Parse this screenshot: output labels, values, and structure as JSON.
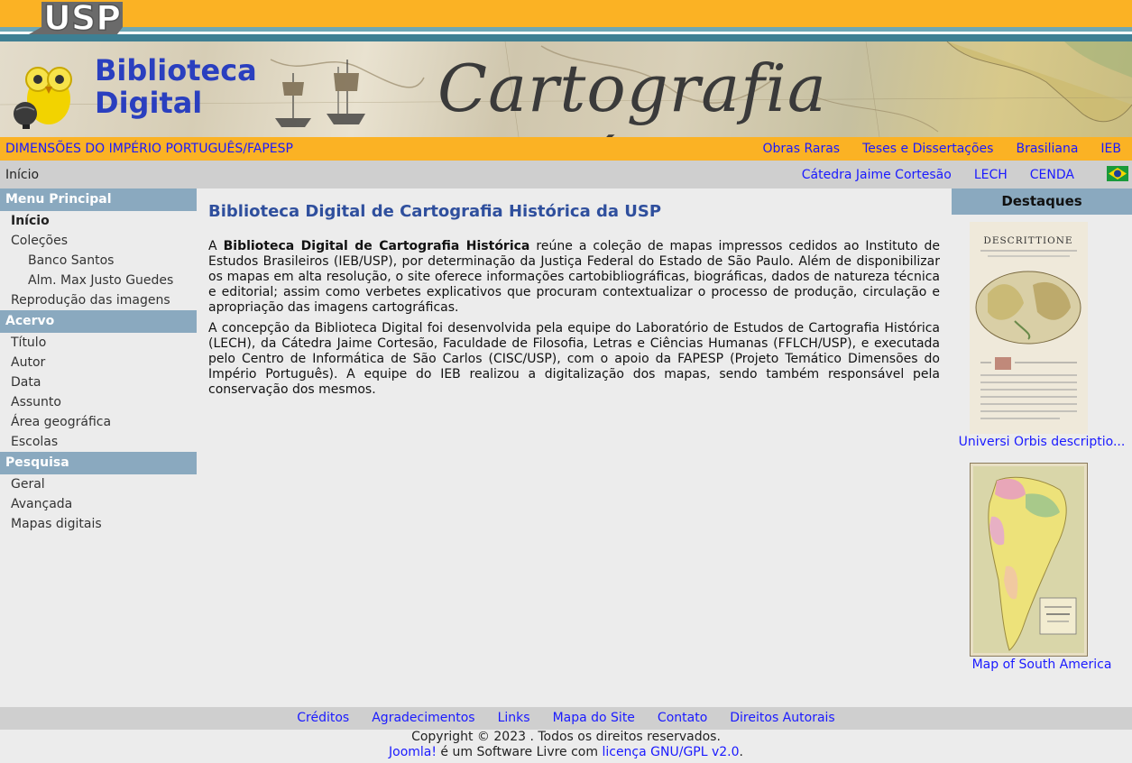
{
  "header": {
    "usp_logo_text": "USP",
    "site_title_line1": "Biblioteca",
    "site_title_line2": "Digital",
    "banner_title": "Cartografia Histórica"
  },
  "nav": {
    "left_link": "DIMENSÕES DO IMPÉRIO PORTUGUÊS/FAPESP",
    "right_links": [
      "Obras Raras",
      "Teses e Dissertações",
      "Brasiliana",
      "IEB"
    ]
  },
  "subnav": {
    "breadcrumb": "Início",
    "links": [
      "Cátedra Jaime Cortesão",
      "LECH",
      "CENDA"
    ]
  },
  "menu": {
    "principal_title": "Menu Principal",
    "principal_items": [
      "Início",
      "Coleções",
      "Banco Santos",
      "Alm. Max Justo Guedes",
      "Reprodução das imagens"
    ],
    "acervo_title": "Acervo",
    "acervo_items": [
      "Título",
      "Autor",
      "Data",
      "Assunto",
      "Área geográfica",
      "Escolas"
    ],
    "pesquisa_title": "Pesquisa",
    "pesquisa_items": [
      "Geral",
      "Avançada",
      "Mapas digitais"
    ]
  },
  "main": {
    "title": "Biblioteca Digital de Cartografia Histórica da USP",
    "p1_prefix": "A ",
    "p1_bold": "Biblioteca Digital de Cartografia Histórica",
    "p1_rest": " reúne a coleção de mapas impressos cedidos ao Instituto de Estudos Brasileiros (IEB/USP), por determinação da Justiça Federal do Estado de São Paulo. Além de disponibilizar os mapas em alta resolução, o site oferece informações cartobibliográficas, biográficas, dados de natureza técnica e editorial; assim como verbetes explicativos que procuram contextualizar o processo de produção, circulação e apropriação das imagens cartográficas.",
    "p2": "A concepção da Biblioteca Digital foi desenvolvida pela equipe do Laboratório de Estudos de Cartografia Histórica (LECH), da Cátedra Jaime Cortesão, Faculdade de Filosofia, Letras e Ciências Humanas (FFLCH/USP), e executada pelo Centro de Informática de São Carlos (CISC/USP), com o apoio da FAPESP (Projeto Temático Dimensões do Império Português). A equipe do IEB realizou a digitalização dos mapas, sendo também responsável pela conservação dos mesmos."
  },
  "highlights": {
    "title": "Destaques",
    "item1_caption": "Universi Orbis descriptio...",
    "item1_heading": "DESCRITTIONE",
    "item2_caption": "Map of South America"
  },
  "footer": {
    "links": [
      "Créditos",
      "Agradecimentos",
      "Links",
      "Mapa do Site",
      "Contato",
      "Direitos Autorais"
    ],
    "copyright": "Copyright © 2023 . Todos os direitos reservados.",
    "joomla_link": "Joomla!",
    "software_text": " é um Software Livre com ",
    "license_link": "licença GNU/GPL v2.0",
    "end_dot": "."
  },
  "colors": {
    "orange": "#fbb224",
    "menu_head": "#8aa9bf",
    "link": "#1a1aff",
    "title_blue": "#2f4f9d"
  }
}
